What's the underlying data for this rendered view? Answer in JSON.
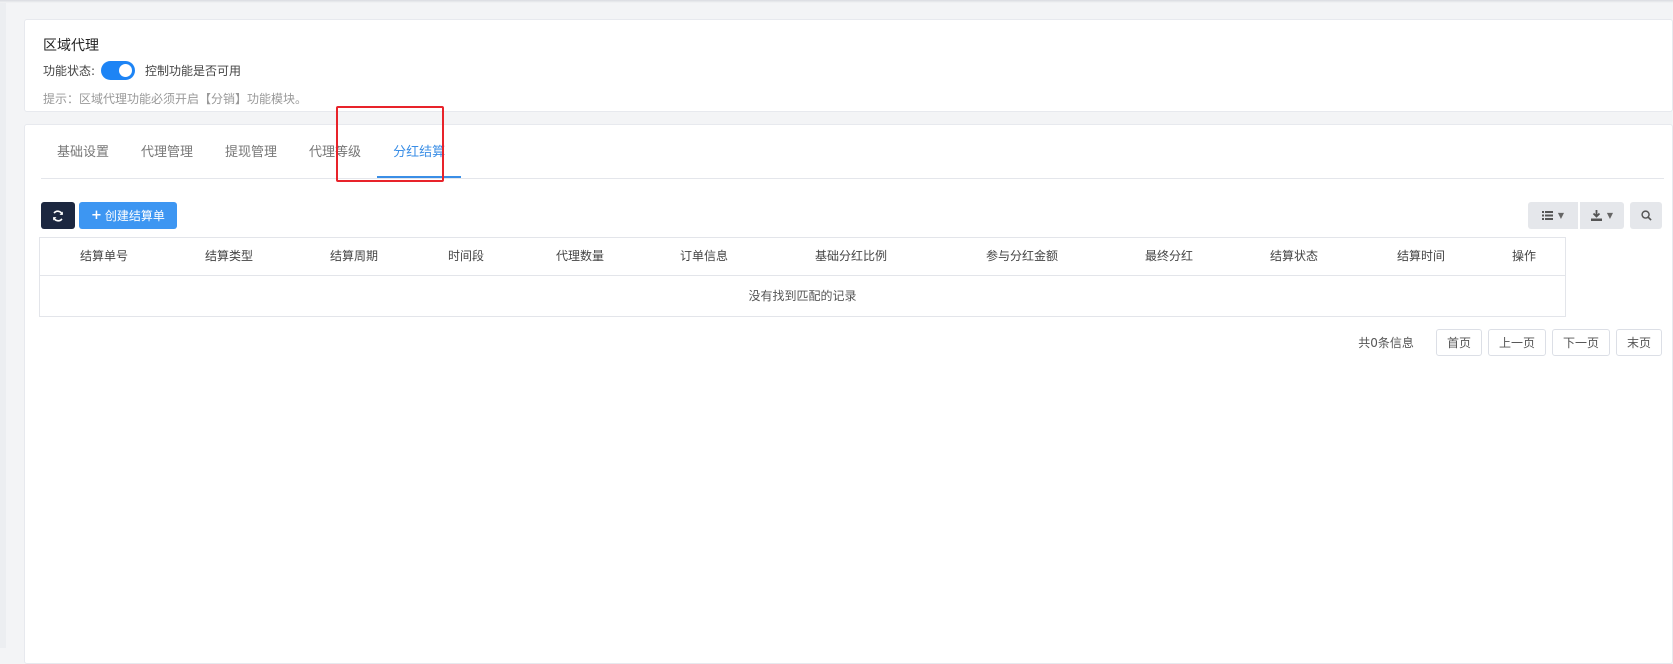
{
  "header": {
    "title": "区域代理",
    "status_label": "功能状态:",
    "status_desc": "控制功能是否可用",
    "tip": "提示：区域代理功能必须开启【分销】功能模块。"
  },
  "tabs": [
    {
      "label": "基础设置"
    },
    {
      "label": "代理管理"
    },
    {
      "label": "提现管理"
    },
    {
      "label": "代理等级"
    },
    {
      "label": "分红结算",
      "active": true
    }
  ],
  "toolbar": {
    "create_label": "创建结算单"
  },
  "table": {
    "columns": [
      "结算单号",
      "结算类型",
      "结算周期",
      "时间段",
      "代理数量",
      "订单信息",
      "基础分红比例",
      "参与分红金额",
      "最终分红",
      "结算状态",
      "结算时间",
      "操作"
    ],
    "empty_text": "没有找到匹配的记录"
  },
  "pager": {
    "total": "共0条信息",
    "first": "首页",
    "prev": "上一页",
    "next": "下一页",
    "last": "末页"
  },
  "colors": {
    "accent": "#3a8ee6",
    "toggle_on": "#1d84f5",
    "refresh_btn": "#1c2740",
    "create_btn": "#3d96f2",
    "highlight": "#e8232a"
  }
}
